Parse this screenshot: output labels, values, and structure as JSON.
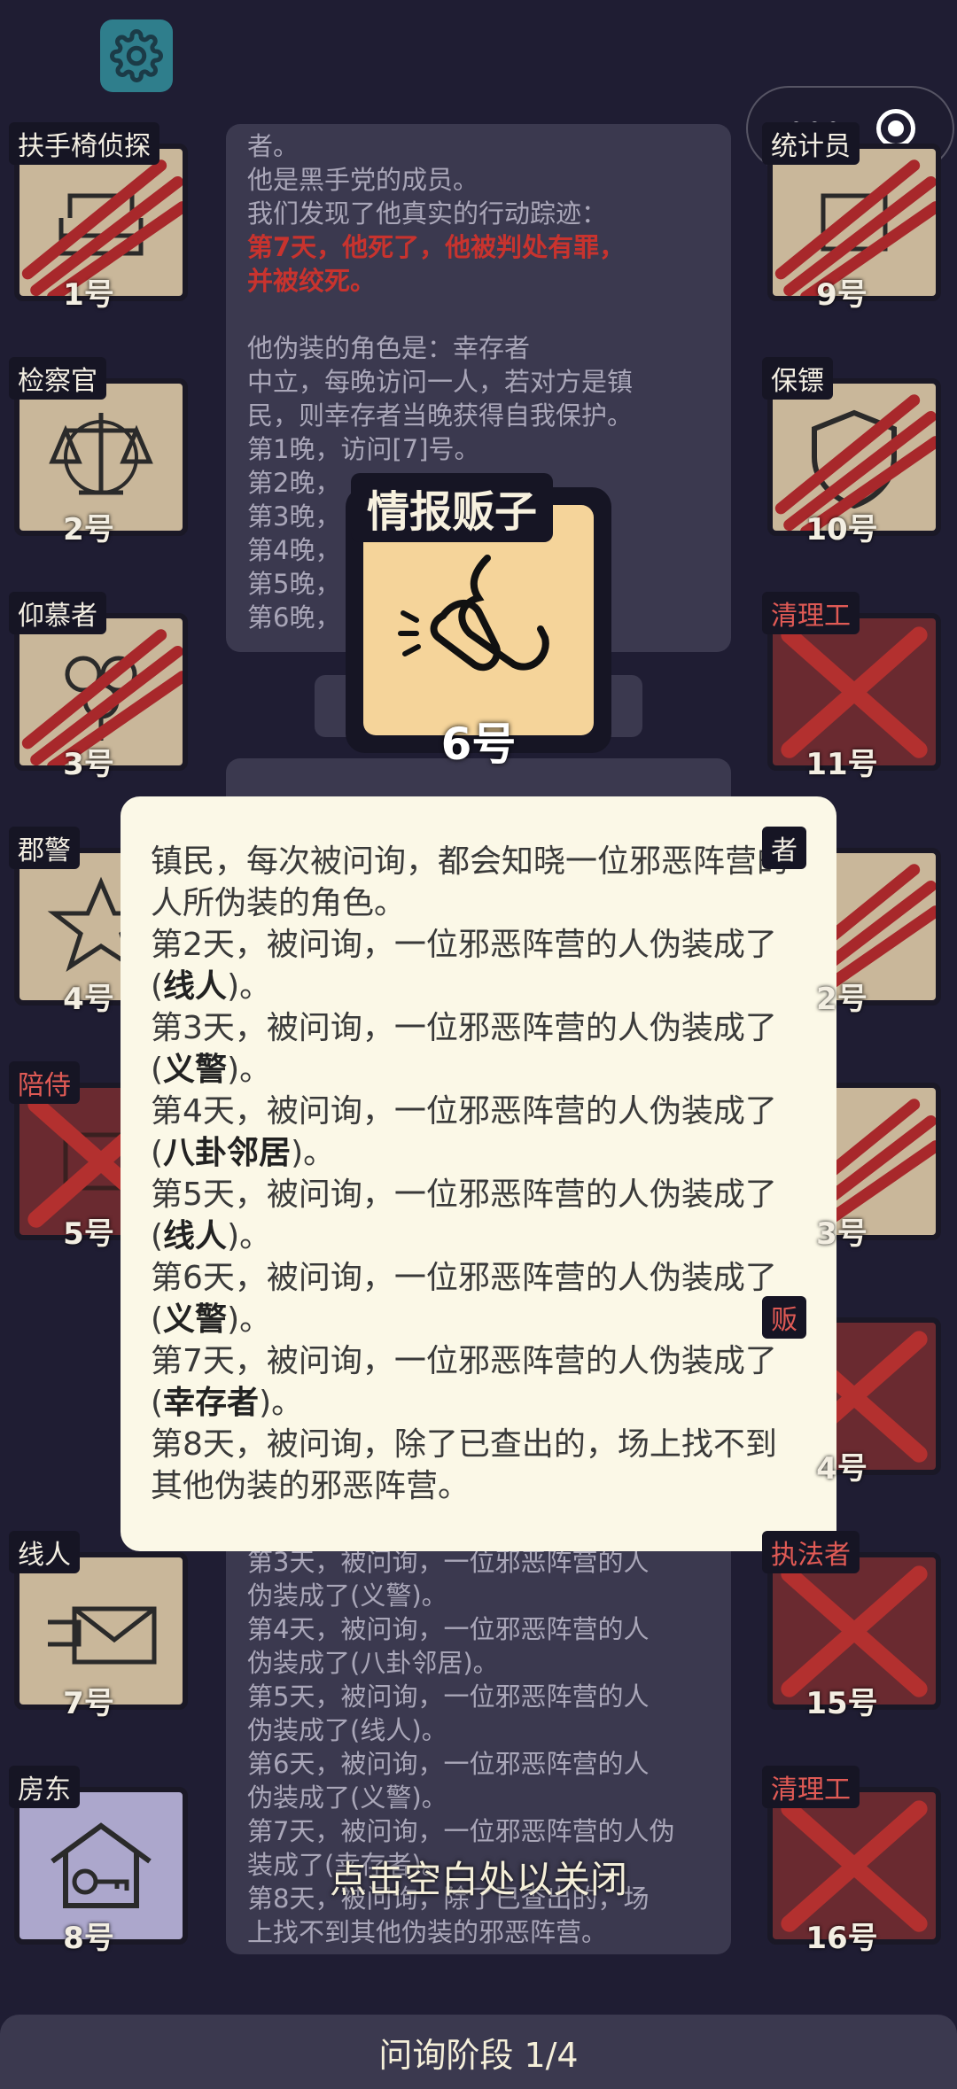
{
  "topbar": {
    "settings_icon": "gear-icon",
    "menu_icon": "more-dots-icon",
    "close_icon": "target-icon"
  },
  "players": [
    {
      "id": 1,
      "role": "扶手椅侦探",
      "number": "1号",
      "state": "clawed"
    },
    {
      "id": 2,
      "role": "检察官",
      "number": "2号",
      "state": "alive"
    },
    {
      "id": 3,
      "role": "仰慕者",
      "number": "3号",
      "state": "clawed"
    },
    {
      "id": 4,
      "role": "郡警",
      "number": "4号",
      "state": "alive"
    },
    {
      "id": 5,
      "role": "陪侍",
      "number": "5号",
      "state": "crossed"
    },
    {
      "id": 7,
      "role": "线人",
      "number": "7号",
      "state": "alive"
    },
    {
      "id": 8,
      "role": "房东",
      "number": "8号",
      "state": "alive"
    },
    {
      "id": 9,
      "role": "统计员",
      "number": "9号",
      "state": "clawed"
    },
    {
      "id": 10,
      "role": "保镖",
      "number": "10号",
      "state": "clawed"
    },
    {
      "id": 11,
      "role": "清理工",
      "number": "11号",
      "state": "crossed"
    },
    {
      "id": 12,
      "role": "者",
      "number": "2号",
      "state": "clawed"
    },
    {
      "id": 13,
      "role": "",
      "number": "3号",
      "state": "clawed"
    },
    {
      "id": 14,
      "role": "贩",
      "number": "4号",
      "state": "crossed"
    },
    {
      "id": 15,
      "role": "执法者",
      "number": "15号",
      "state": "crossed"
    },
    {
      "id": 16,
      "role": "清理工",
      "number": "16号",
      "state": "crossed"
    }
  ],
  "log_top": {
    "lines": [
      "者。",
      "他是黑手党的成员。",
      "我们发现了他真实的行动踪迹："
    ],
    "red_lines": [
      "第7天，他死了，他被判处有罪，",
      "并被绞死。"
    ],
    "disguise_lines": [
      "他伪装的角色是：幸存者",
      "中立，每晚访问一人，若对方是镇",
      "民，则幸存者当晚获得自我保护。",
      "第1晚，访问[7]号。",
      "第2晚，",
      "第3晚，",
      "第4晚，",
      "第5晚，",
      "第6晚，"
    ]
  },
  "log_bottom": {
    "lines": [
      "第3天，被问询，一位邪恶阵营的人",
      "伪装成了(义警)。",
      "第4天，被问询，一位邪恶阵营的人",
      "伪装成了(八卦邻居)。",
      "第5天，被问询，一位邪恶阵营的人",
      "伪装成了(线人)。",
      "第6天，被问询，一位邪恶阵营的人",
      "伪装成了(义警)。",
      "第7天，被问询，一位邪恶阵营的人伪",
      "装成了(幸存者)。",
      "第8天，被问询，除了已查出的，场",
      "上找不到其他伪装的邪恶阵营。"
    ]
  },
  "spy": {
    "role": "情报贩子",
    "number": "6号",
    "icon": "whisper-icon"
  },
  "dialog": {
    "intro": "镇民，每次被问询，都会知晓一位邪恶阵营的人所伪装的角色。",
    "entries": [
      {
        "prefix": "第2天，被问询，一位邪恶阵营的人伪装成了(",
        "role": "线人",
        "suffix": ")。"
      },
      {
        "prefix": "第3天，被问询，一位邪恶阵营的人伪装成了(",
        "role": "义警",
        "suffix": ")。"
      },
      {
        "prefix": "第4天，被问询，一位邪恶阵营的人伪装成了(",
        "role": "八卦邻居",
        "suffix": ")。"
      },
      {
        "prefix": "第5天，被问询，一位邪恶阵营的人伪装成了(",
        "role": "线人",
        "suffix": ")。"
      },
      {
        "prefix": "第6天，被问询，一位邪恶阵营的人伪装成了(",
        "role": "义警",
        "suffix": ")。"
      },
      {
        "prefix": "第7天，被问询，一位邪恶阵营的人伪装成了(",
        "role": "幸存者",
        "suffix": ")。"
      }
    ],
    "final": "第8天，被问询，除了已查出的，场上找不到其他伪装的邪恶阵营。"
  },
  "hint": "点击空白处以关闭",
  "phase": "问询阶段 1/4"
}
